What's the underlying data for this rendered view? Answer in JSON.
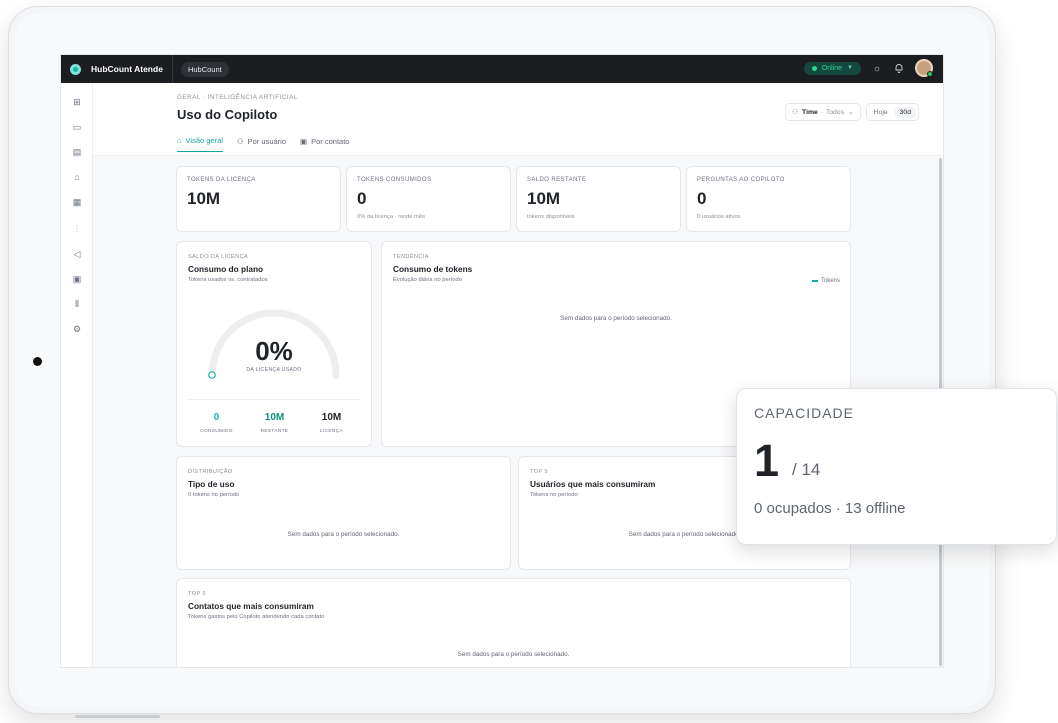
{
  "topbar": {
    "app_name": "HubCount Atende",
    "workspace": "HubCount",
    "status": "Online"
  },
  "sidebar": {
    "icons": [
      "grid-icon",
      "chat-icon",
      "inbox-icon",
      "robot-icon",
      "document-icon",
      "chart-icon",
      "megaphone-icon",
      "billing-icon",
      "library-icon",
      "gear-icon"
    ]
  },
  "header": {
    "breadcrumb": "GERAL · INTELIGÊNCIA ARTIFICIAL",
    "title": "Uso do Copiloto",
    "team_filter_label": "Time",
    "team_filter_value": "· Todos",
    "range_today": "Hoje",
    "range_30d": "30d"
  },
  "tabs": [
    {
      "label": "Visão geral",
      "icon": "home-icon"
    },
    {
      "label": "Por usuário",
      "icon": "users-icon"
    },
    {
      "label": "Por contato",
      "icon": "contact-icon"
    }
  ],
  "kpis": [
    {
      "label": "TOKENS DA LICENÇA",
      "value": "10M",
      "sub": ""
    },
    {
      "label": "TOKENS CONSUMIDOS",
      "value": "0",
      "sub": "0% da licença · neste mês"
    },
    {
      "label": "SALDO RESTANTE",
      "value": "10M",
      "sub": "tokens disponíveis"
    },
    {
      "label": "PERGUNTAS AO COPILOTO",
      "value": "0",
      "sub": "0 usuários ativos"
    }
  ],
  "balance": {
    "label": "SALDO DA LICENÇA",
    "title": "Consumo do plano",
    "sub": "Tokens usados vs. contratados",
    "percent": "0%",
    "percent_label": "DA LICENÇA USADO",
    "used_fraction": 0,
    "stats": [
      {
        "value": "0",
        "label": "CONSUMIDO",
        "color": "#14b8a6"
      },
      {
        "value": "10M",
        "label": "RESTANTE",
        "color": "#0f8f7e"
      },
      {
        "value": "10M",
        "label": "LICENÇA",
        "color": "#1f2328"
      }
    ]
  },
  "trend": {
    "label": "TENDÊNCIA",
    "title": "Consumo de tokens",
    "sub": "Evolução diária no período",
    "legend": "Tokens",
    "empty": "Sem dados para o período selecionado."
  },
  "distribution": {
    "label": "DISTRIBUIÇÃO",
    "title": "Tipo de uso",
    "sub": "0 tokens no período",
    "empty": "Sem dados para o período selecionado."
  },
  "top_users": {
    "label": "TOP 5",
    "title": "Usuários que mais consumiram",
    "sub": "Tokens no período",
    "empty": "Sem dados para o período selecionado."
  },
  "top_contacts": {
    "label": "TOP 5",
    "title": "Contatos que mais consumiram",
    "sub": "Tokens gastos pelo Copiloto atendendo cada contato",
    "empty": "Sem dados para o período selecionado."
  },
  "capacity": {
    "label": "CAPACIDADE",
    "value": "1",
    "of": "/ 14",
    "sub": "0 ocupados · 13 offline"
  }
}
